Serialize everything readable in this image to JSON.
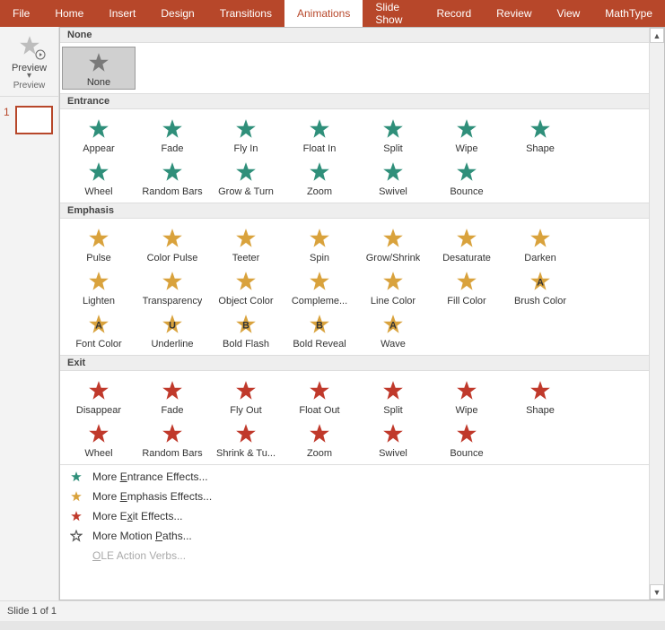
{
  "ribbon": {
    "tabs": [
      "File",
      "Home",
      "Insert",
      "Design",
      "Transitions",
      "Animations",
      "Slide Show",
      "Record",
      "Review",
      "View",
      "MathType"
    ],
    "active": "Animations"
  },
  "preview": {
    "label": "Preview",
    "section": "Preview"
  },
  "slides": {
    "current_num": "1"
  },
  "categories": {
    "none": {
      "title": "None",
      "items": [
        {
          "id": "none",
          "label": "None",
          "color": "#7a7a7a",
          "selected": true
        }
      ]
    },
    "entrance": {
      "title": "Entrance",
      "color": "#2f8f7a",
      "items": [
        {
          "id": "appear",
          "label": "Appear"
        },
        {
          "id": "fade",
          "label": "Fade"
        },
        {
          "id": "flyin",
          "label": "Fly In"
        },
        {
          "id": "floatin",
          "label": "Float In"
        },
        {
          "id": "split",
          "label": "Split"
        },
        {
          "id": "wipe",
          "label": "Wipe"
        },
        {
          "id": "shape",
          "label": "Shape"
        },
        {
          "id": "wheel",
          "label": "Wheel"
        },
        {
          "id": "randombars",
          "label": "Random Bars"
        },
        {
          "id": "growturn",
          "label": "Grow & Turn"
        },
        {
          "id": "zoom",
          "label": "Zoom"
        },
        {
          "id": "swivel",
          "label": "Swivel"
        },
        {
          "id": "bounce",
          "label": "Bounce"
        }
      ]
    },
    "emphasis": {
      "title": "Emphasis",
      "color": "#d9a23c",
      "items": [
        {
          "id": "pulse",
          "label": "Pulse"
        },
        {
          "id": "colorpulse",
          "label": "Color Pulse"
        },
        {
          "id": "teeter",
          "label": "Teeter"
        },
        {
          "id": "spin",
          "label": "Spin"
        },
        {
          "id": "growshrink",
          "label": "Grow/Shrink"
        },
        {
          "id": "desaturate",
          "label": "Desaturate"
        },
        {
          "id": "darken",
          "label": "Darken"
        },
        {
          "id": "lighten",
          "label": "Lighten"
        },
        {
          "id": "transparency",
          "label": "Transparency"
        },
        {
          "id": "objectcolor",
          "label": "Object Color"
        },
        {
          "id": "complementary",
          "label": "Compleme..."
        },
        {
          "id": "linecolor",
          "label": "Line Color"
        },
        {
          "id": "fillcolor",
          "label": "Fill Color"
        },
        {
          "id": "brushcolor",
          "label": "Brush Color",
          "badge": "A"
        },
        {
          "id": "fontcolor",
          "label": "Font Color",
          "badge": "A"
        },
        {
          "id": "underline",
          "label": "Underline",
          "badge": "U"
        },
        {
          "id": "boldflash",
          "label": "Bold Flash",
          "badge": "B"
        },
        {
          "id": "boldreveal",
          "label": "Bold Reveal",
          "badge": "B"
        },
        {
          "id": "wave",
          "label": "Wave",
          "badge": "A"
        }
      ]
    },
    "exit": {
      "title": "Exit",
      "color": "#c0392b",
      "items": [
        {
          "id": "disappear",
          "label": "Disappear"
        },
        {
          "id": "fade",
          "label": "Fade"
        },
        {
          "id": "flyout",
          "label": "Fly Out"
        },
        {
          "id": "floatout",
          "label": "Float Out"
        },
        {
          "id": "split",
          "label": "Split"
        },
        {
          "id": "wipe",
          "label": "Wipe"
        },
        {
          "id": "shape",
          "label": "Shape"
        },
        {
          "id": "wheel",
          "label": "Wheel"
        },
        {
          "id": "randombars",
          "label": "Random Bars"
        },
        {
          "id": "shrinkturn",
          "label": "Shrink & Tu..."
        },
        {
          "id": "zoom",
          "label": "Zoom"
        },
        {
          "id": "swivel",
          "label": "Swivel"
        },
        {
          "id": "bounce",
          "label": "Bounce"
        }
      ]
    }
  },
  "more": [
    {
      "id": "more-entrance",
      "label": "More Entrance Effects...",
      "hot": "E",
      "color": "#2f8f7a"
    },
    {
      "id": "more-emphasis",
      "label": "More Emphasis Effects...",
      "hot": "E",
      "color": "#d9a23c"
    },
    {
      "id": "more-exit",
      "label": "More Exit Effects...",
      "hot": "x",
      "color": "#c0392b"
    },
    {
      "id": "more-motion",
      "label": "More Motion Paths...",
      "hot": "P",
      "color": "#555",
      "outline": true
    },
    {
      "id": "ole",
      "label": "OLE Action Verbs...",
      "hot": "O",
      "disabled": true
    }
  ],
  "status": {
    "text": "Slide 1 of 1"
  }
}
